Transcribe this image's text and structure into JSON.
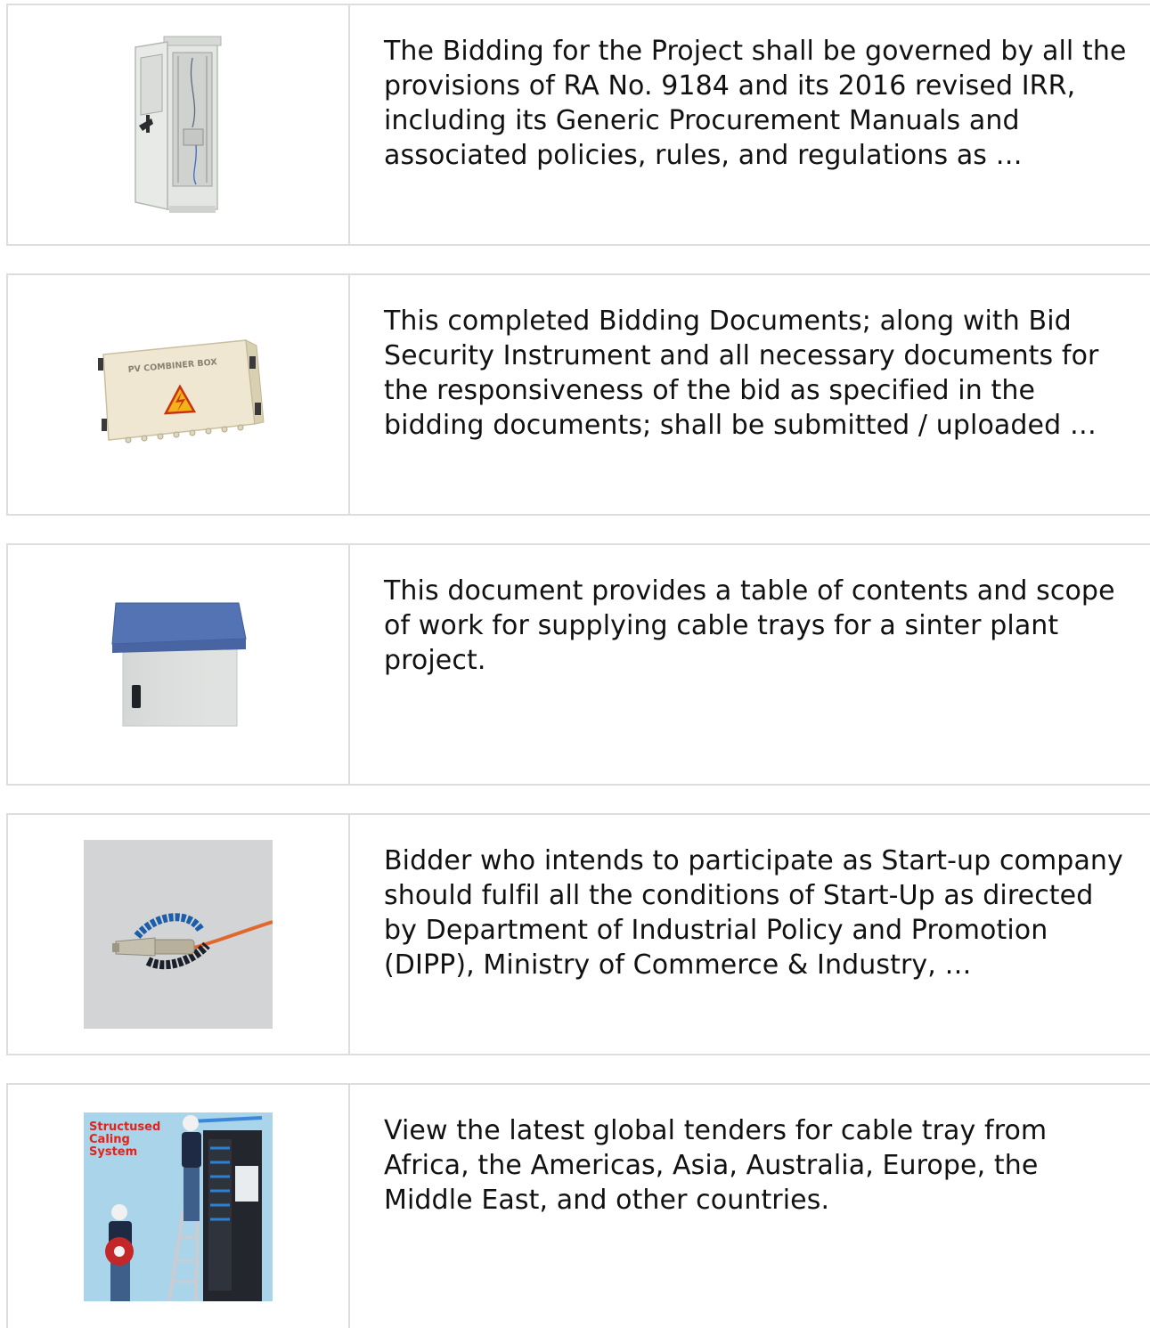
{
  "results": [
    {
      "thumbnail_icon": "outdoor-cabinet-open-door-image",
      "snippet": "The Bidding for the Project shall be governed by all the provisions of RA No. 9184 and its 2016 revised IRR, including its Generic Procurement Manuals and associated policies, rules, and regulations as …"
    },
    {
      "thumbnail_icon": "pv-combiner-box-image",
      "thumbnail_text": "PV COMBINER BOX",
      "snippet": "This completed Bidding Documents; along with Bid Security Instrument and all necessary documents for the responsiveness of the bid as specified in the bidding documents; shall be submitted / uploaded …"
    },
    {
      "thumbnail_icon": "outdoor-enclosure-blue-roof-image",
      "snippet": "This document provides a table of contents and scope of work for supplying cable trays for a sinter plant project."
    },
    {
      "thumbnail_icon": "fiber-optic-connector-image",
      "snippet": "Bidder who intends to participate as Start-up company should fulfil all the conditions of Start-Up as directed by Department of Industrial Policy and Promotion (DIPP), Ministry of Commerce & Industry, …"
    },
    {
      "thumbnail_icon": "structured-cabling-technicians-image",
      "thumbnail_text": "Structused Caling System",
      "snippet": "View the latest global tenders for cable tray from Africa, the Americas, Asia, Australia, Europe, the Middle East, and other countries."
    }
  ]
}
